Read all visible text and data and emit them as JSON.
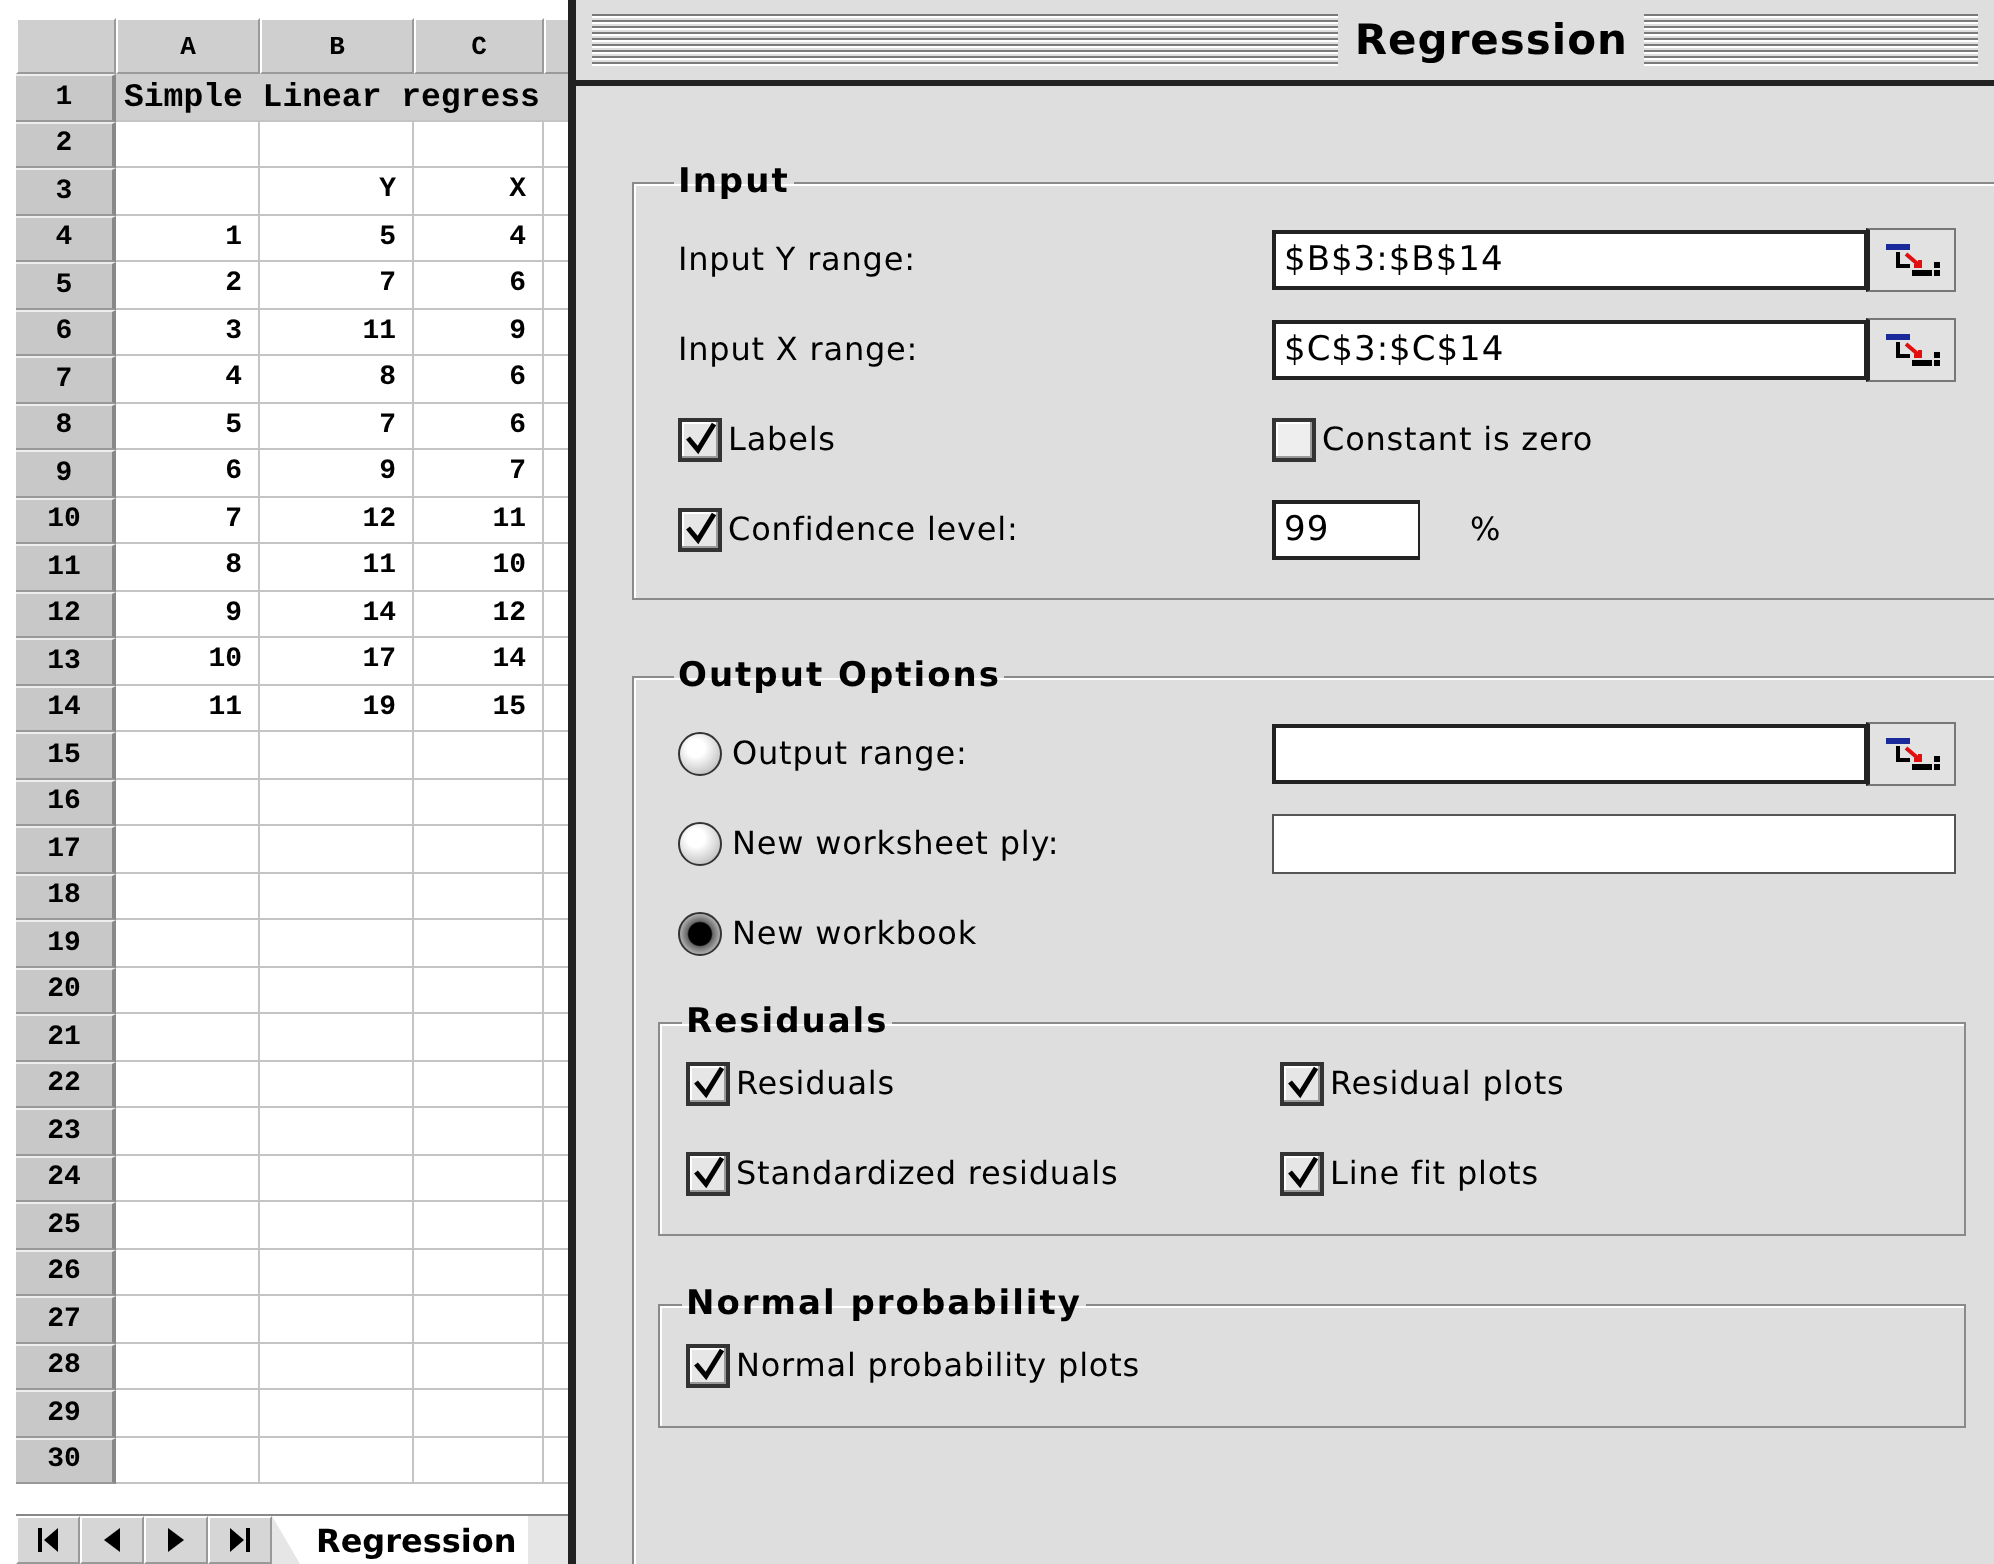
{
  "spreadsheet": {
    "columns": [
      "A",
      "B",
      "C"
    ],
    "rows": [
      {
        "number": "1",
        "title": "Simple Linear regress"
      },
      {
        "number": "2"
      },
      {
        "number": "3",
        "b": "Y",
        "c": "X"
      },
      {
        "number": "4",
        "a": "1",
        "b": "5",
        "c": "4"
      },
      {
        "number": "5",
        "a": "2",
        "b": "7",
        "c": "6"
      },
      {
        "number": "6",
        "a": "3",
        "b": "11",
        "c": "9"
      },
      {
        "number": "7",
        "a": "4",
        "b": "8",
        "c": "6"
      },
      {
        "number": "8",
        "a": "5",
        "b": "7",
        "c": "6"
      },
      {
        "number": "9",
        "a": "6",
        "b": "9",
        "c": "7"
      },
      {
        "number": "10",
        "a": "7",
        "b": "12",
        "c": "11"
      },
      {
        "number": "11",
        "a": "8",
        "b": "11",
        "c": "10"
      },
      {
        "number": "12",
        "a": "9",
        "b": "14",
        "c": "12"
      },
      {
        "number": "13",
        "a": "10",
        "b": "17",
        "c": "14"
      },
      {
        "number": "14",
        "a": "11",
        "b": "19",
        "c": "15"
      },
      {
        "number": "15"
      },
      {
        "number": "16"
      },
      {
        "number": "17"
      },
      {
        "number": "18"
      },
      {
        "number": "19"
      },
      {
        "number": "20"
      },
      {
        "number": "21"
      },
      {
        "number": "22"
      },
      {
        "number": "23"
      },
      {
        "number": "24"
      },
      {
        "number": "25"
      },
      {
        "number": "26"
      },
      {
        "number": "27"
      },
      {
        "number": "28"
      },
      {
        "number": "29"
      },
      {
        "number": "30"
      }
    ],
    "sheet_tabs": [
      {
        "label": "Regression",
        "selected": true
      }
    ]
  },
  "dialog": {
    "title": "Regression",
    "input": {
      "title": "Input",
      "ranges": [
        {
          "label": "Input Y range:",
          "value": "$B$3:$B$14"
        },
        {
          "label": "Input X range:",
          "value": "$C$3:$C$14"
        }
      ],
      "labels": {
        "label": "Labels",
        "checked": true
      },
      "constant_is_zero": {
        "label": "Constant is zero",
        "checked": false
      },
      "confidence": {
        "label": "Confidence level:",
        "checked": true,
        "value": "99",
        "unit": "%"
      }
    },
    "output": {
      "title": "Output Options",
      "options": [
        {
          "label": "Output range:",
          "selected": false,
          "kind": "range"
        },
        {
          "label": "New worksheet ply:",
          "selected": false,
          "kind": "text"
        },
        {
          "label": "New workbook",
          "selected": true
        }
      ],
      "residuals": {
        "title": "Residuals",
        "options": [
          {
            "label": "Residuals",
            "checked": true
          },
          {
            "label": "Residual plots",
            "checked": true
          },
          {
            "label": "Standardized residuals",
            "checked": true
          },
          {
            "label": "Line fit plots",
            "checked": true
          }
        ]
      },
      "normal_probability": {
        "title": "Normal probability",
        "options": [
          {
            "label": "Normal probability plots",
            "checked": true
          }
        ]
      }
    }
  }
}
